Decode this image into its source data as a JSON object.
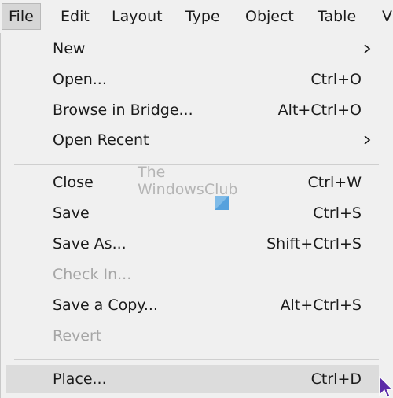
{
  "menubar": {
    "items": [
      "File",
      "Edit",
      "Layout",
      "Type",
      "Object",
      "Table",
      "Vi"
    ],
    "active": "File"
  },
  "file_menu": {
    "items": [
      {
        "label": "New",
        "shortcut": "",
        "submenu": true,
        "disabled": false
      },
      {
        "label": "Open...",
        "shortcut": "Ctrl+O",
        "submenu": false,
        "disabled": false
      },
      {
        "label": "Browse in Bridge...",
        "shortcut": "Alt+Ctrl+O",
        "submenu": false,
        "disabled": false
      },
      {
        "label": "Open Recent",
        "shortcut": "",
        "submenu": true,
        "disabled": false
      },
      {
        "label": "Close",
        "shortcut": "Ctrl+W",
        "submenu": false,
        "disabled": false
      },
      {
        "label": "Save",
        "shortcut": "Ctrl+S",
        "submenu": false,
        "disabled": false
      },
      {
        "label": "Save As...",
        "shortcut": "Shift+Ctrl+S",
        "submenu": false,
        "disabled": false
      },
      {
        "label": "Check In...",
        "shortcut": "",
        "submenu": false,
        "disabled": true
      },
      {
        "label": "Save a Copy...",
        "shortcut": "Alt+Ctrl+S",
        "submenu": false,
        "disabled": false
      },
      {
        "label": "Revert",
        "shortcut": "",
        "submenu": false,
        "disabled": true
      },
      {
        "label": "Place...",
        "shortcut": "Ctrl+D",
        "submenu": false,
        "disabled": false,
        "hovered": true
      }
    ]
  },
  "watermark": {
    "line1": "The",
    "line2": "WindowsClub",
    "logo_icon": "windows-logo-icon"
  },
  "colors": {
    "background": "#f0f0f0",
    "text": "#1a1a1a",
    "disabled_text": "#a6a6a6",
    "hover": "#dcdcdc",
    "separator": "#cfcfcf",
    "cursor": "#5b2aa8",
    "watermark_logo": "#5aa9e6"
  }
}
